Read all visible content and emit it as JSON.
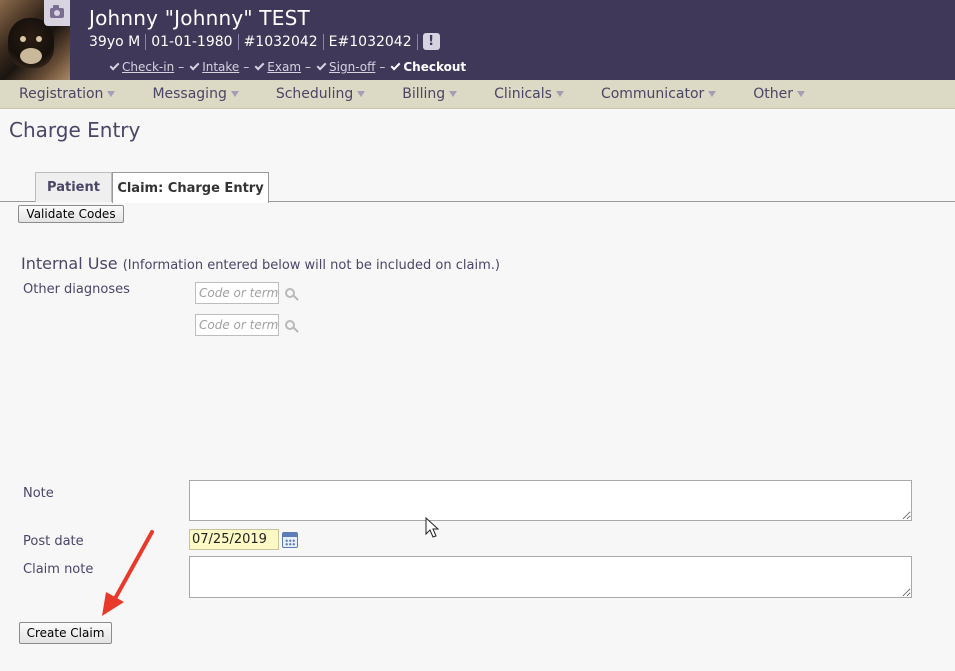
{
  "patient": {
    "name": "Johnny \"Johnny\" TEST",
    "age_sex": "39yo M",
    "dob": "01-01-1980",
    "chart_id": "#1032042",
    "e_id": "E#1032042",
    "alert_icon": "exclamation-badge-icon"
  },
  "workflow": {
    "steps": [
      {
        "label": "Check-in",
        "done": true
      },
      {
        "label": "Intake",
        "done": true
      },
      {
        "label": "Exam",
        "done": true
      },
      {
        "label": "Sign-off",
        "done": true
      },
      {
        "label": "Checkout",
        "done": true
      }
    ],
    "separator": "–"
  },
  "menu": {
    "items": [
      "Registration",
      "Messaging",
      "Scheduling",
      "Billing",
      "Clinicals",
      "Communicator",
      "Other"
    ]
  },
  "page": {
    "title": "Charge Entry"
  },
  "tabs": [
    {
      "label": "Patient",
      "active": false
    },
    {
      "label": "Claim: Charge Entry",
      "active": true
    }
  ],
  "validate_button": "Validate Codes",
  "internal": {
    "title": "Internal Use",
    "note": "(Information entered below will not be included on claim.)",
    "other_diagnoses_label": "Other diagnoses",
    "code_placeholder": "Code or term"
  },
  "form": {
    "note_label": "Note",
    "post_date_label": "Post date",
    "post_date_value": "07/25/2019",
    "claim_note_label": "Claim note"
  },
  "create_button": "Create Claim",
  "colors": {
    "header_bg": "#3f3859",
    "menubar_bg": "#dcd9c4",
    "accent_text": "#4b4567",
    "date_highlight": "#fdf9c4",
    "annotation_arrow": "#e8392a"
  }
}
